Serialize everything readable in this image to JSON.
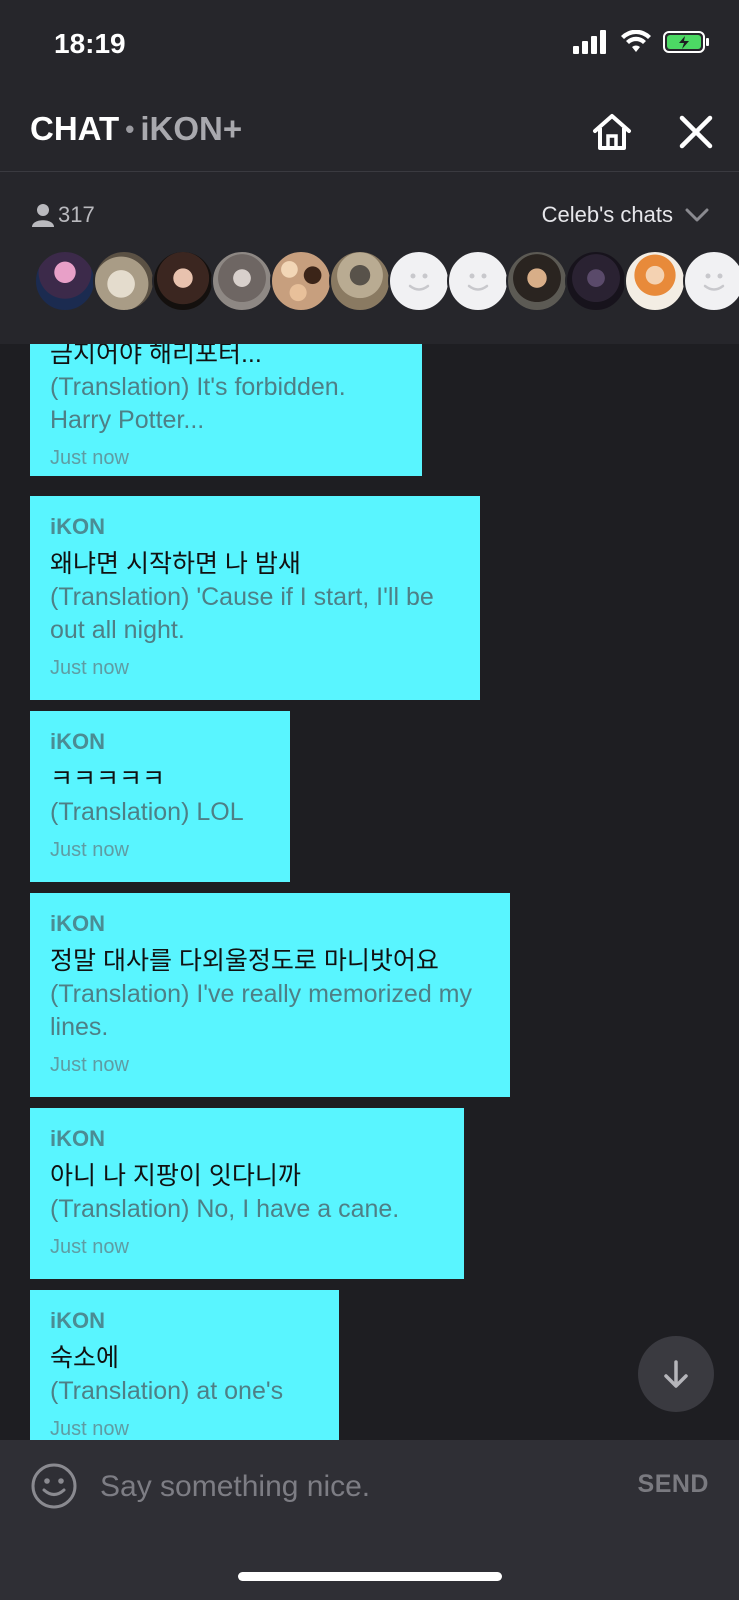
{
  "status_bar": {
    "time": "18:19"
  },
  "header": {
    "title_main": "CHAT",
    "title_separator": "•",
    "title_channel": "iKON+"
  },
  "participants": {
    "count": "317",
    "celebs_label": "Celeb's chats",
    "avatars": [
      "photo",
      "photo",
      "photo",
      "photo",
      "photo",
      "photo",
      "default",
      "default",
      "photo",
      "photo",
      "photo",
      "default"
    ]
  },
  "messages": [
    {
      "sender": "",
      "korean": "금지어야 해리포터...",
      "translation": "(Translation) It's forbidden. Harry Potter...",
      "time": "Just now"
    },
    {
      "sender": "iKON",
      "korean": "왜냐면 시작하면 나 밤새",
      "translation": "(Translation) 'Cause if I start, I'll be out all night.",
      "time": "Just now"
    },
    {
      "sender": "iKON",
      "korean": "ㅋㅋㅋㅋㅋ",
      "translation": "(Translation) LOL",
      "time": "Just now"
    },
    {
      "sender": "iKON",
      "korean": "정말 대사를 다외울정도로 마니밧어요",
      "translation": "(Translation) I've really memorized my lines.",
      "time": "Just now"
    },
    {
      "sender": "iKON",
      "korean": "아니 나 지팡이 잇다니까",
      "translation": "(Translation) No, I have a cane.",
      "time": "Just now"
    },
    {
      "sender": "iKON",
      "korean": "숙소에",
      "translation": "(Translation) at one's",
      "time": "Just now"
    }
  ],
  "input": {
    "placeholder": "Say something nice.",
    "send_label": "SEND"
  },
  "colors": {
    "bubble": "#59f5ff",
    "background": "#1e1e22",
    "bar": "#26262b",
    "battery": "#4cd964"
  },
  "icons": [
    "signal-icon",
    "wifi-icon",
    "battery-icon",
    "home-icon",
    "close-icon",
    "person-icon",
    "chevron-down-icon",
    "arrow-down-icon",
    "emoji-icon"
  ]
}
